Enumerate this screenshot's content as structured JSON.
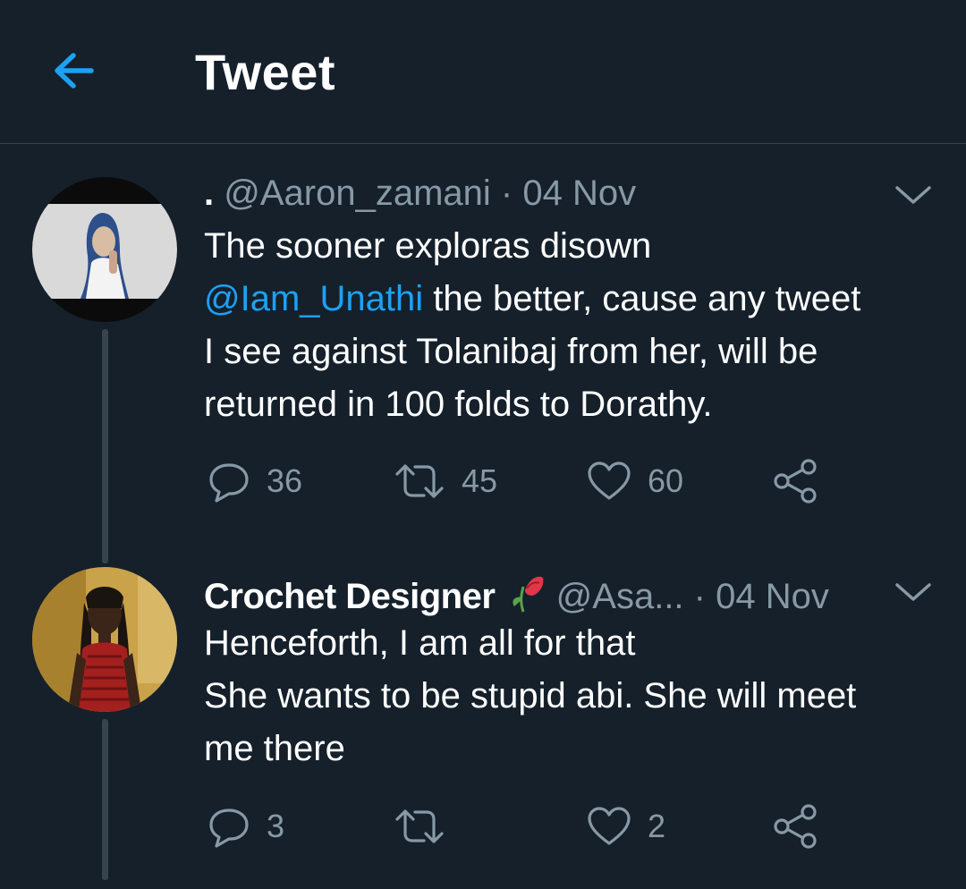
{
  "header": {
    "title": "Tweet"
  },
  "tweets": [
    {
      "name": ".",
      "handle": "@Aaron_zamani",
      "separator": "·",
      "date": "04 Nov",
      "lines": [
        "The sooner exploras disown",
        {
          "mention": "@Iam_Unathi",
          "rest": " the better, cause any tweet"
        },
        "I see against Tolanibaj from her, will be",
        "returned in 100 folds to Dorathy."
      ],
      "replies": "36",
      "retweets": "45",
      "likes": "60"
    },
    {
      "name": "Crochet Designer",
      "name_emoji": "🥀",
      "handle": "@Asa...",
      "separator": "·",
      "date": "04 Nov",
      "lines": [
        "Henceforth, I am all for that",
        "She wants to be stupid abi. She will meet",
        "me there"
      ],
      "replies": "3",
      "retweets": "",
      "likes": "2"
    }
  ],
  "colors": {
    "background": "#15202b",
    "accent": "#1da1f2",
    "muted": "#8899a6",
    "divider": "#38444d"
  },
  "icons": [
    "back-arrow-icon",
    "chevron-down-icon",
    "reply-icon",
    "retweet-icon",
    "like-icon",
    "share-icon",
    "wilted-rose-icon"
  ]
}
